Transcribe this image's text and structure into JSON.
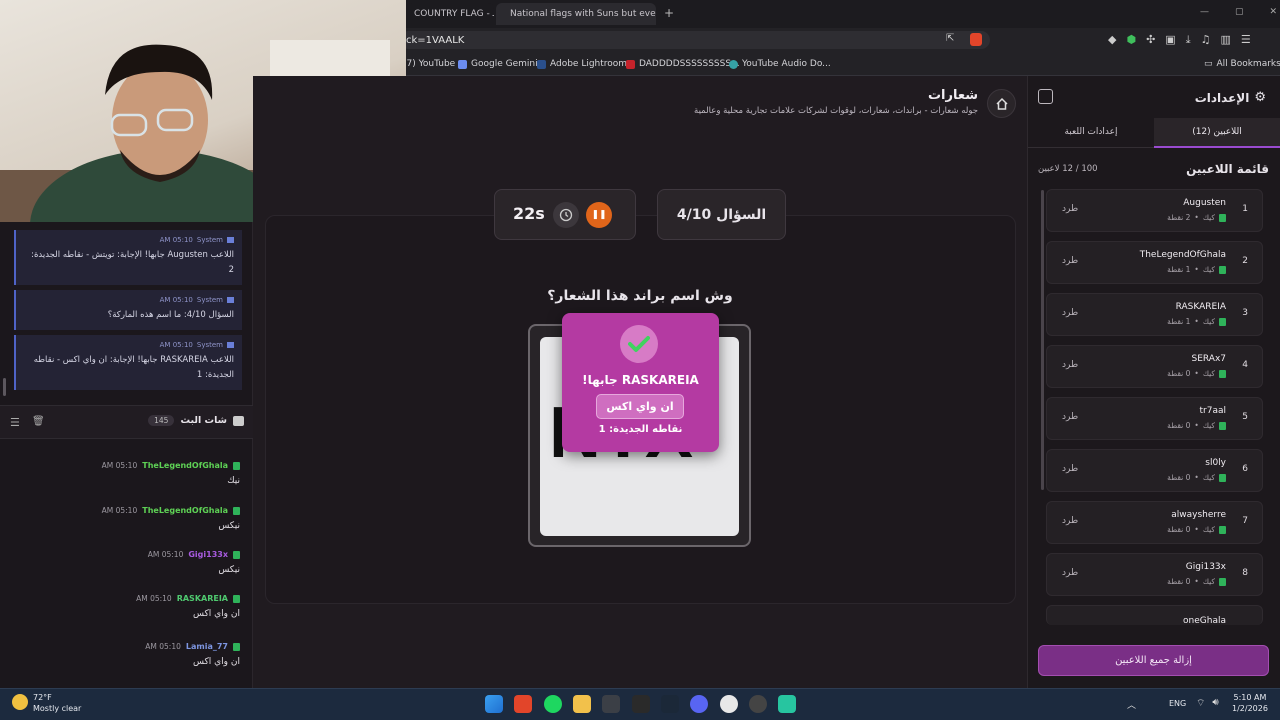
{
  "browser": {
    "tabs": [
      "COUNTRY FLAG - تحـ",
      "National flags with Suns but every su"
    ],
    "url": "ck=1VAALK",
    "bookmarks": [
      "(7) YouTube",
      "Google Gemini",
      "Adobe Lightroom",
      "DADDDDSSSSSSSSS...",
      "YouTube Audio Do..."
    ],
    "all_bookmarks": "All Bookmarks"
  },
  "system_messages": [
    {
      "meta_user": "System",
      "time": "05:10 AM",
      "text": "اللاعب Augusten جابها! الإجابة: تويتش - نقاطه الجديدة: 2"
    },
    {
      "meta_user": "System",
      "time": "05:10 AM",
      "text": "السؤال 4/10: ما اسم هذه الماركة؟"
    },
    {
      "meta_user": "System",
      "time": "05:10 AM",
      "text": "اللاعب RASKAREIA جابها! الإجابة: ان واي اكس - نقاطه الجديدة: 1"
    }
  ],
  "chat": {
    "title": "شات البث",
    "count": "145",
    "messages": [
      {
        "user": "TheLegendOfGhala",
        "time": "05:10 AM",
        "text": "نيك",
        "color": "#5ed155"
      },
      {
        "user": "TheLegendOfGhala",
        "time": "05:10 AM",
        "text": "نيكس",
        "color": "#5ed155"
      },
      {
        "user": "Gigi133x",
        "time": "05:10 AM",
        "text": "نيكس",
        "color": "#a85be0"
      },
      {
        "user": "RASKAREIA",
        "time": "05:10 AM",
        "text": "ان واي اكس",
        "color": "#4fc96f"
      },
      {
        "user": "Lamia_77",
        "time": "05:10 AM",
        "text": "ان واي اكس",
        "color": "#7d95e0"
      }
    ]
  },
  "category": {
    "title": "شعارات",
    "description": "جوله شعارات - براندات، شعارات، لوقوات لشركات علامات تجارية محلية وعالمية"
  },
  "game": {
    "question_counter": "السؤال 4/10",
    "timer": "22s",
    "question": "وش اسم براند هذا الشعار؟",
    "logo_text": "NYX",
    "correct": {
      "who": "RASKAREIA جابها!",
      "answer": "ان واي اكس",
      "points": "نقاطه الجديدة: 1"
    }
  },
  "settings_panel": {
    "title": "الإعدادات",
    "tab_players": "اللاعبين (12)",
    "tab_game": "إعدادات اللعبة",
    "list_title": "قائمة اللاعبين",
    "list_count": "100 / 12 لاعبين",
    "kick_label": "طرد",
    "platform_label": "كيك",
    "players": [
      {
        "rank": "1",
        "name": "Augusten",
        "points": "2 نقطة"
      },
      {
        "rank": "2",
        "name": "TheLegendOfGhala",
        "points": "1 نقطة"
      },
      {
        "rank": "3",
        "name": "RASKAREIA",
        "points": "1 نقطة"
      },
      {
        "rank": "4",
        "name": "SERAx7",
        "points": "0 نقطة"
      },
      {
        "rank": "5",
        "name": "tr7aal",
        "points": "0 نقطة"
      },
      {
        "rank": "6",
        "name": "sl0ly",
        "points": "0 نقطة"
      },
      {
        "rank": "7",
        "name": "alwaysherre",
        "points": "0 نقطة"
      },
      {
        "rank": "8",
        "name": "Gigi133x",
        "points": "0 نقطة"
      }
    ],
    "partial_player": "oneGhala",
    "clear_all": "إزالة جميع اللاعبين"
  },
  "taskbar": {
    "weather_temp": "72°F",
    "weather_desc": "Mostly clear",
    "lang": "ENG",
    "time": "5:10 AM",
    "date": "1/2/2026"
  }
}
